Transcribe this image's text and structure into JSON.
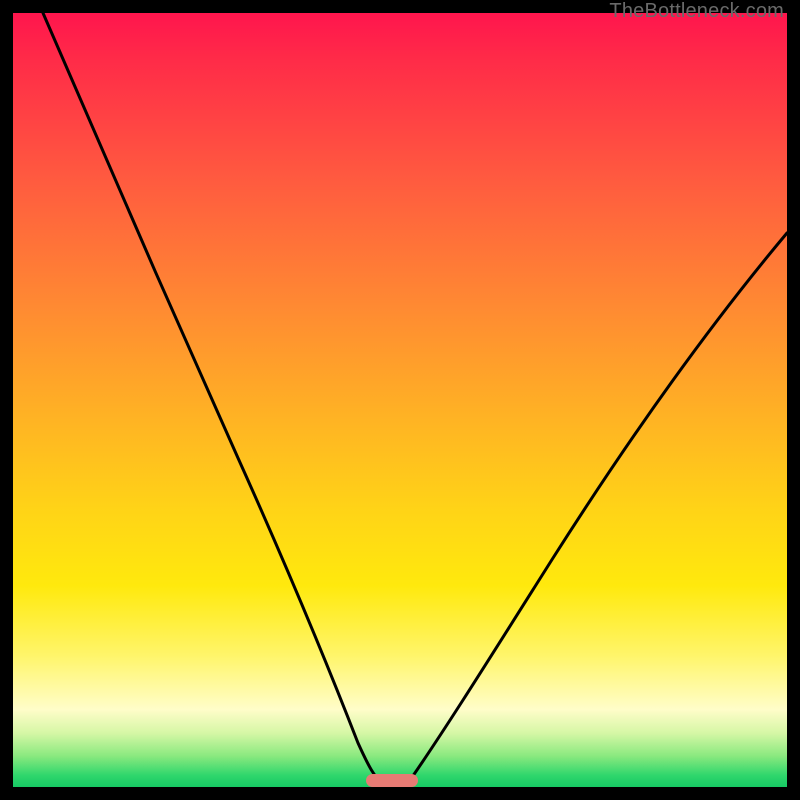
{
  "watermark": "TheBottleneck.com",
  "colors": {
    "curve_stroke": "#000000",
    "marker_fill": "#e77b74",
    "frame_bg": "#000000"
  },
  "chart_data": {
    "type": "line",
    "title": "",
    "xlabel": "",
    "ylabel": "",
    "xlim": [
      0,
      100
    ],
    "ylim": [
      0,
      100
    ],
    "grid": false,
    "note": "Values below are estimates read from the rendered curve in normalized 0-100 coordinates (origin bottom-left). Two branches meet at a minimum near x≈48.",
    "series": [
      {
        "name": "curve",
        "x": [
          0,
          5,
          10,
          16,
          22,
          28,
          34,
          38,
          42,
          45,
          47,
          48,
          50,
          52,
          55,
          60,
          66,
          73,
          80,
          88,
          95,
          100
        ],
        "y": [
          100,
          92,
          84,
          75,
          65,
          54,
          41,
          32,
          22,
          12,
          5,
          2,
          2,
          5,
          10,
          18,
          28,
          39,
          49,
          59,
          67,
          72
        ]
      }
    ],
    "marker": {
      "x_center": 48.2,
      "y": 1.2,
      "width": 6.0,
      "height": 1.6
    }
  }
}
